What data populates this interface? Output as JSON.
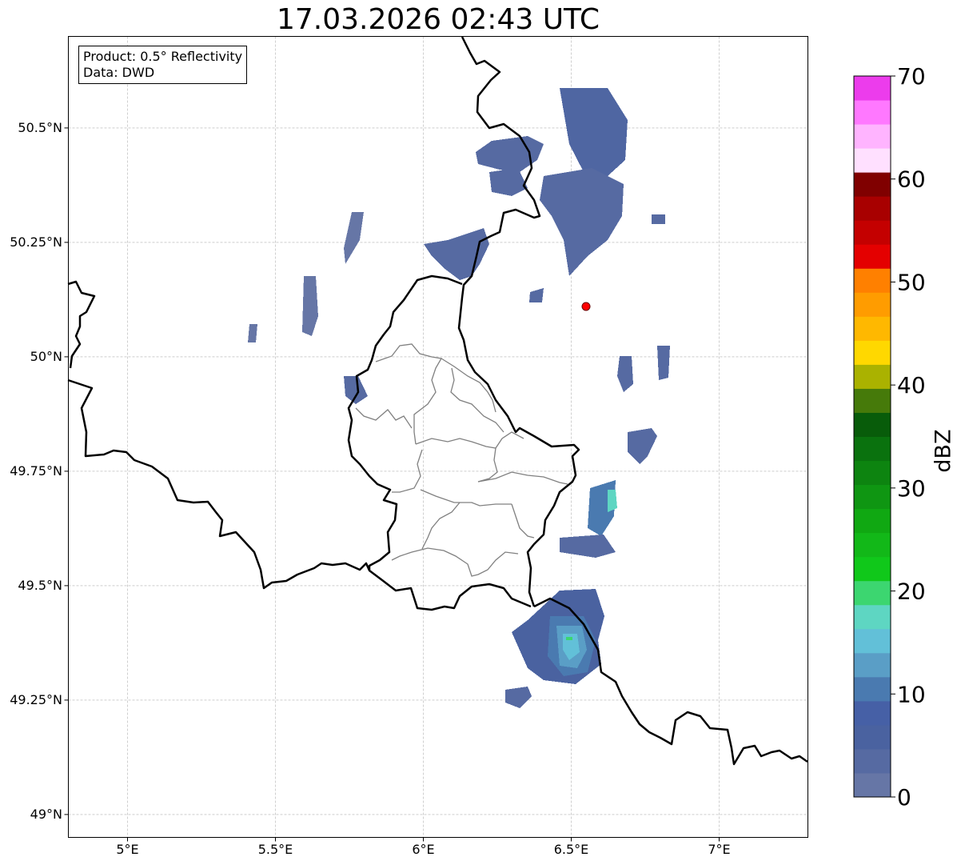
{
  "title": "17.03.2026 02:43 UTC",
  "infobox": {
    "product": "Product: 0.5° Reflectivity",
    "data": "Data: DWD"
  },
  "map": {
    "lon_range": [
      4.8,
      7.3
    ],
    "lat_range": [
      48.95,
      50.7
    ],
    "lon_ticks": [
      {
        "value": 5.0,
        "label": "5°E"
      },
      {
        "value": 5.5,
        "label": "5.5°E"
      },
      {
        "value": 6.0,
        "label": "6°E"
      },
      {
        "value": 6.5,
        "label": "6.5°E"
      },
      {
        "value": 7.0,
        "label": "7°E"
      }
    ],
    "lat_ticks": [
      {
        "value": 50.5,
        "label": "50.5°N"
      },
      {
        "value": 50.25,
        "label": "50.25°N"
      },
      {
        "value": 50.0,
        "label": "50°N"
      },
      {
        "value": 49.75,
        "label": "49.75°N"
      },
      {
        "value": 49.5,
        "label": "49.5°N"
      },
      {
        "value": 49.25,
        "label": "49.25°N"
      },
      {
        "value": 49.0,
        "label": "49°N"
      }
    ],
    "gridlines": true,
    "radar_site": {
      "lon": 6.55,
      "lat": 50.11,
      "color": "#ff0000"
    }
  },
  "colorbar": {
    "label": "dBZ",
    "min": 0,
    "max": 70,
    "tick_labels": [
      "0",
      "10",
      "20",
      "30",
      "40",
      "50",
      "60",
      "70"
    ],
    "colors": [
      "#6676a6",
      "#566aa2",
      "#4a62a0",
      "#4660a6",
      "#4a7ab0",
      "#5a9ec6",
      "#62c0d8",
      "#5ed6c2",
      "#3cd670",
      "#10c81a",
      "#12b818",
      "#10a812",
      "#0f9612",
      "#0d8410",
      "#0a720e",
      "#085c0a",
      "#467a0a",
      "#aab200",
      "#ffd800",
      "#ffb800",
      "#ff9c00",
      "#ff8000",
      "#e40000",
      "#c40000",
      "#a80000",
      "#800000",
      "#ffe0ff",
      "#ffb4ff",
      "#ff78ff",
      "#ec3cec"
    ]
  }
}
